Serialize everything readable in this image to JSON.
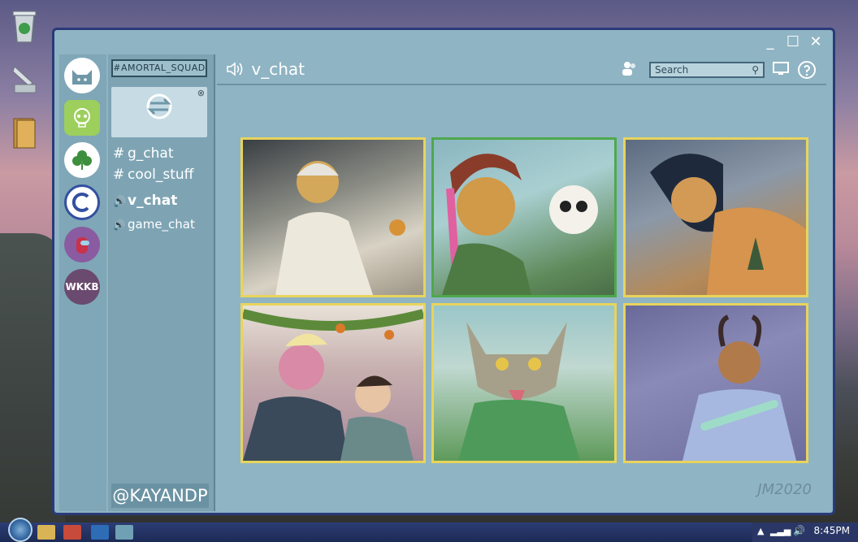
{
  "window": {
    "controls": {
      "minimize": "_",
      "maximize": "☐",
      "close": "✕"
    }
  },
  "servers": [
    {
      "name": "cat-server",
      "color": "#ffffff",
      "bg": "#8fb4c3"
    },
    {
      "name": "skull-server",
      "color": "#9ccf5c",
      "bg": "#9ccf5c"
    },
    {
      "name": "clover-server",
      "color": "#3a8a3a",
      "bg": "#b5dba0"
    },
    {
      "name": "c-server",
      "color": "#3350a0",
      "bg": "#ffffff"
    },
    {
      "name": "amongus-server",
      "color": "#6a3a7a",
      "bg": "#8a5ba0"
    },
    {
      "name": "wkkb-server",
      "color": "#ffffff",
      "bg": "#6a4a6e",
      "label": "WKKB"
    }
  ],
  "channel_list": {
    "server_name": "#AMORTAL_SQUAD",
    "banner_close": "⊗",
    "channels": [
      {
        "prefix": "#",
        "label": "g_chat",
        "type": "text"
      },
      {
        "prefix": "#",
        "label": "cool_stuff",
        "type": "text"
      },
      {
        "prefix": "🔊",
        "label": "v_chat",
        "type": "voice",
        "active": true
      },
      {
        "prefix": "🔊",
        "label": "game_chat",
        "type": "voice"
      }
    ],
    "user_handle": "@KAYANDP"
  },
  "header": {
    "channel_title": "v_chat",
    "search_placeholder": "Search"
  },
  "tiles": [
    {
      "name": "tile-1",
      "border": "yellow",
      "bg": "#c7c3b6"
    },
    {
      "name": "tile-2",
      "border": "green",
      "bg": "#6e8f6a"
    },
    {
      "name": "tile-3",
      "border": "yellow",
      "bg": "#7b8a96"
    },
    {
      "name": "tile-4",
      "border": "yellow",
      "bg": "#c8a6a8"
    },
    {
      "name": "tile-5",
      "border": "yellow",
      "bg": "#8aa46a"
    },
    {
      "name": "tile-6",
      "border": "yellow",
      "bg": "#7a7aa6"
    }
  ],
  "signature": "JM2020",
  "taskbar": {
    "clock": "8:45PM"
  }
}
